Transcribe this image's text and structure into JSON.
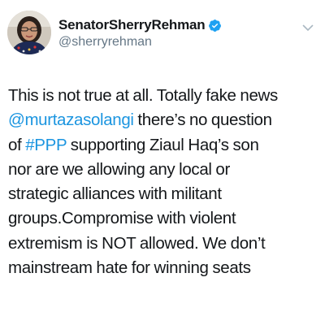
{
  "tweet": {
    "display_name": "SenatorSherryRehman",
    "handle": "@sherryrehman",
    "verified": true,
    "icons": {
      "avatar": "profile-photo",
      "verified": "verified-badge-icon",
      "menu": "chevron-down-icon"
    },
    "colors": {
      "text": "#14171a",
      "secondary": "#657786",
      "link": "#1b95e0",
      "verified": "#1da1f2",
      "chevron": "#aab8c2"
    },
    "body_lines": [
      [
        {
          "text": "This is not true at all. Totally fake news",
          "kind": "text"
        }
      ],
      [
        {
          "text": "@murtazasolangi",
          "kind": "mention"
        },
        {
          "text": " there’s no question",
          "kind": "text"
        }
      ],
      [
        {
          "text": "of ",
          "kind": "text"
        },
        {
          "text": "#PPP",
          "kind": "hashtag"
        },
        {
          "text": " supporting Ziaul Haq’s son",
          "kind": "text"
        }
      ],
      [
        {
          "text": "nor are we allowing any local or",
          "kind": "text"
        }
      ],
      [
        {
          "text": "strategic alliances with militant",
          "kind": "text"
        }
      ],
      [
        {
          "text": "groups.Compromise with violent",
          "kind": "text"
        }
      ],
      [
        {
          "text": "extremism is NOT allowed. We don’t",
          "kind": "text"
        }
      ],
      [
        {
          "text": "mainstream hate for winning seats",
          "kind": "text"
        }
      ]
    ]
  }
}
